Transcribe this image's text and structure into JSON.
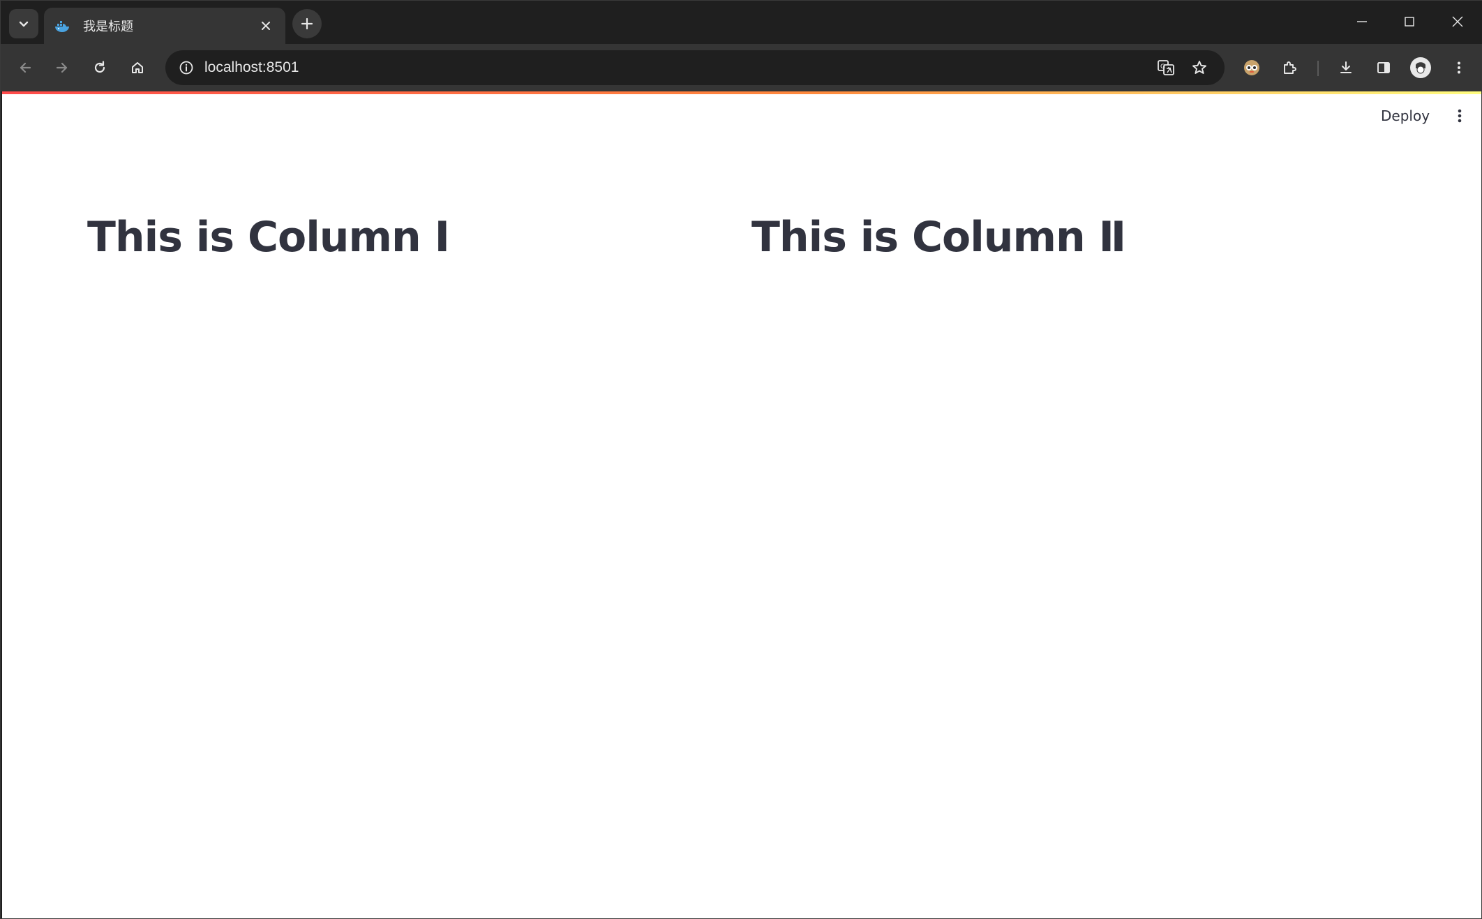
{
  "browser": {
    "tab": {
      "title": "我是标题",
      "favicon": "whale-favicon-icon"
    },
    "address_bar": {
      "url": "localhost:8501"
    },
    "colors": {
      "frame": "#1f1f1f",
      "toolbar": "#353535",
      "text": "#e8e8e8"
    }
  },
  "app": {
    "header": {
      "deploy_label": "Deploy"
    },
    "columns": [
      {
        "heading": "This is Column Ⅰ"
      },
      {
        "heading": "This is Column Ⅱ"
      }
    ],
    "colors": {
      "heading": "#31333f",
      "decoration_start": "#ff4b4b",
      "decoration_end": "#fffd80"
    }
  }
}
